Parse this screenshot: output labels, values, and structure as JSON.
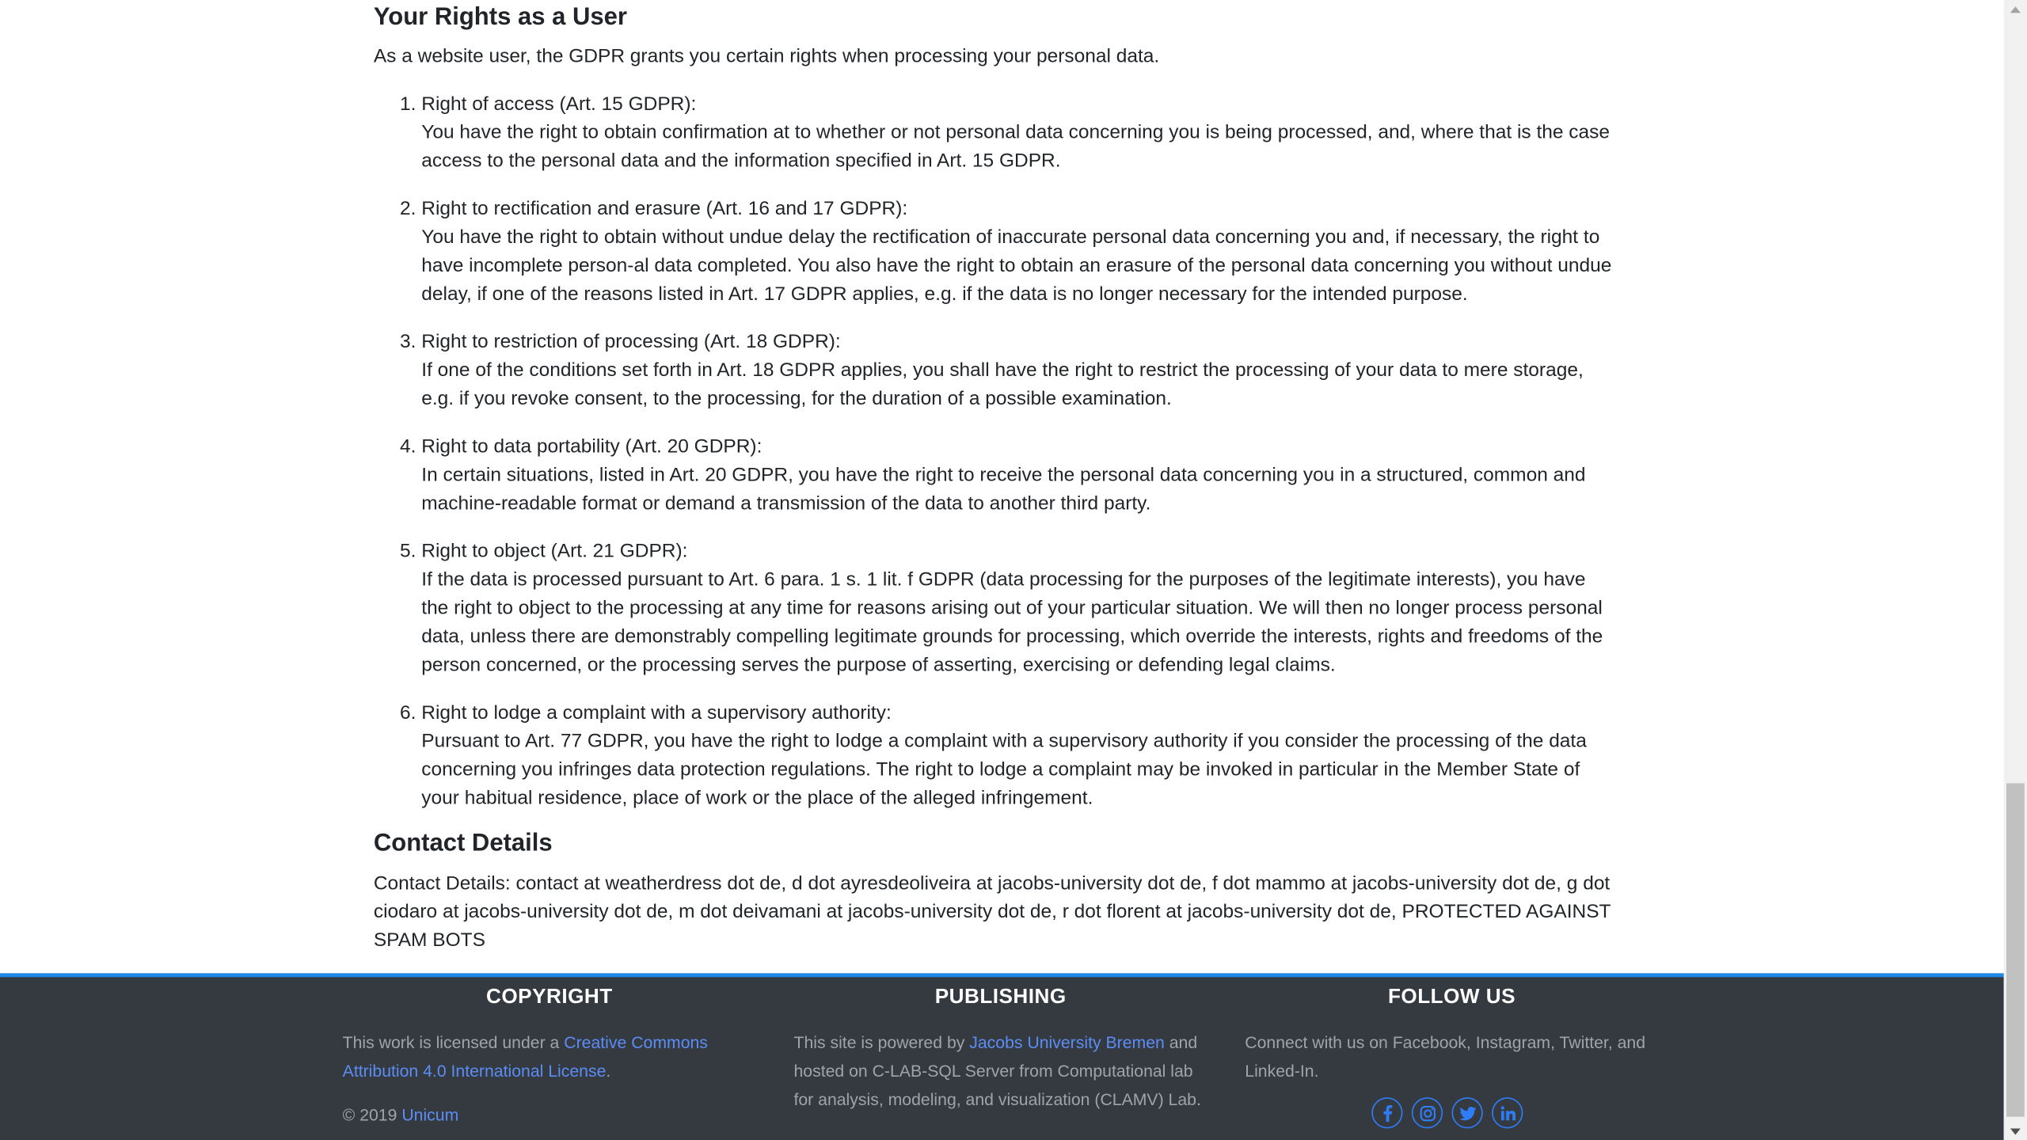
{
  "rights": {
    "title": "Your Rights as a User",
    "intro": "As a website user, the GDPR grants you certain rights when processing your personal data.",
    "items": [
      {
        "title": "Right of access (Art. 15 GDPR):",
        "text": "You have the right to obtain confirmation at to whether or not personal data concerning you is being processed, and, where that is the case access to the personal data and the information specified in Art. 15 GDPR."
      },
      {
        "title": "Right to rectification and erasure (Art. 16 and 17 GDPR):",
        "text": "You have the right to obtain without undue delay the rectification of inaccurate personal data concerning you and, if necessary, the right to have incomplete person-al data completed. You also have the right to obtain an erasure of the personal data concerning you without undue delay, if one of the reasons listed in Art. 17 GDPR applies, e.g. if the data is no longer necessary for the intended purpose."
      },
      {
        "title": "Right to restriction of processing (Art. 18 GDPR):",
        "text": "If one of the conditions set forth in Art. 18 GDPR applies, you shall have the right to restrict the processing of your data to mere storage, e.g. if you revoke consent, to the processing, for the duration of a possible examination."
      },
      {
        "title": "Right to data portability (Art. 20 GDPR):",
        "text": "In certain situations, listed in Art. 20 GDPR, you have the right to receive the personal data concerning you in a structured, common and machine-readable format or demand a transmission of the data to another third party."
      },
      {
        "title": "Right to object (Art. 21 GDPR):",
        "text": "If the data is processed pursuant to Art. 6 para. 1 s. 1 lit. f GDPR (data processing for the purposes of the legitimate interests), you have the right to object to the processing at any time for reasons arising out of your particular situation. We will then no longer process personal data, unless there are demonstrably compelling legitimate grounds for processing, which override the interests, rights and freedoms of the person concerned, or the processing serves the purpose of asserting, exercising or defending legal claims."
      },
      {
        "title": "Right to lodge a complaint with a supervisory authority:",
        "text": "Pursuant to Art. 77 GDPR, you have the right to lodge a complaint with a supervisory authority if you consider the processing of the data concerning you infringes data protection regulations. The right to lodge a complaint may be invoked in particular in the Member State of your habitual residence, place of work or the place of the alleged infringement."
      }
    ]
  },
  "contact": {
    "title": "Contact Details",
    "text": "Contact Details: contact at weatherdress dot de, d dot ayresdeoliveira at jacobs-university dot de, f dot mammo at jacobs-university dot de, g dot ciodaro at jacobs-university dot de, m dot deivamani at jacobs-university dot de, r dot florent at jacobs-university dot de, PROTECTED AGAINST SPAM BOTS"
  },
  "footer": {
    "copyright": {
      "heading": "COPYRIGHT",
      "text_before": "This work is licensed under a ",
      "license_link": "Creative Commons Attribution 4.0 International License",
      "text_after": ".",
      "year_text": "© 2019 ",
      "owner_link": "Unicum"
    },
    "publishing": {
      "heading": "PUBLISHING",
      "text_before": "This site is powered by ",
      "university_link": "Jacobs University Bremen",
      "text_after": " and hosted on C-LAB-SQL Server from Computational lab for analysis, modeling, and visualization (CLAMV) Lab."
    },
    "follow": {
      "heading": "FOLLOW US",
      "text": "Connect with us on Facebook, Instagram, Twitter, and Linked-In.",
      "social": [
        {
          "icon": "facebook-icon",
          "glyph": "f"
        },
        {
          "icon": "instagram-icon",
          "glyph": ""
        },
        {
          "icon": "twitter-icon",
          "glyph": ""
        },
        {
          "icon": "linkedin-icon",
          "glyph": "in"
        }
      ]
    }
  },
  "colors": {
    "accent": "#1e88e5",
    "footer_bg": "#343a40",
    "link": "#5b8df5",
    "social": "#2f7df6"
  }
}
